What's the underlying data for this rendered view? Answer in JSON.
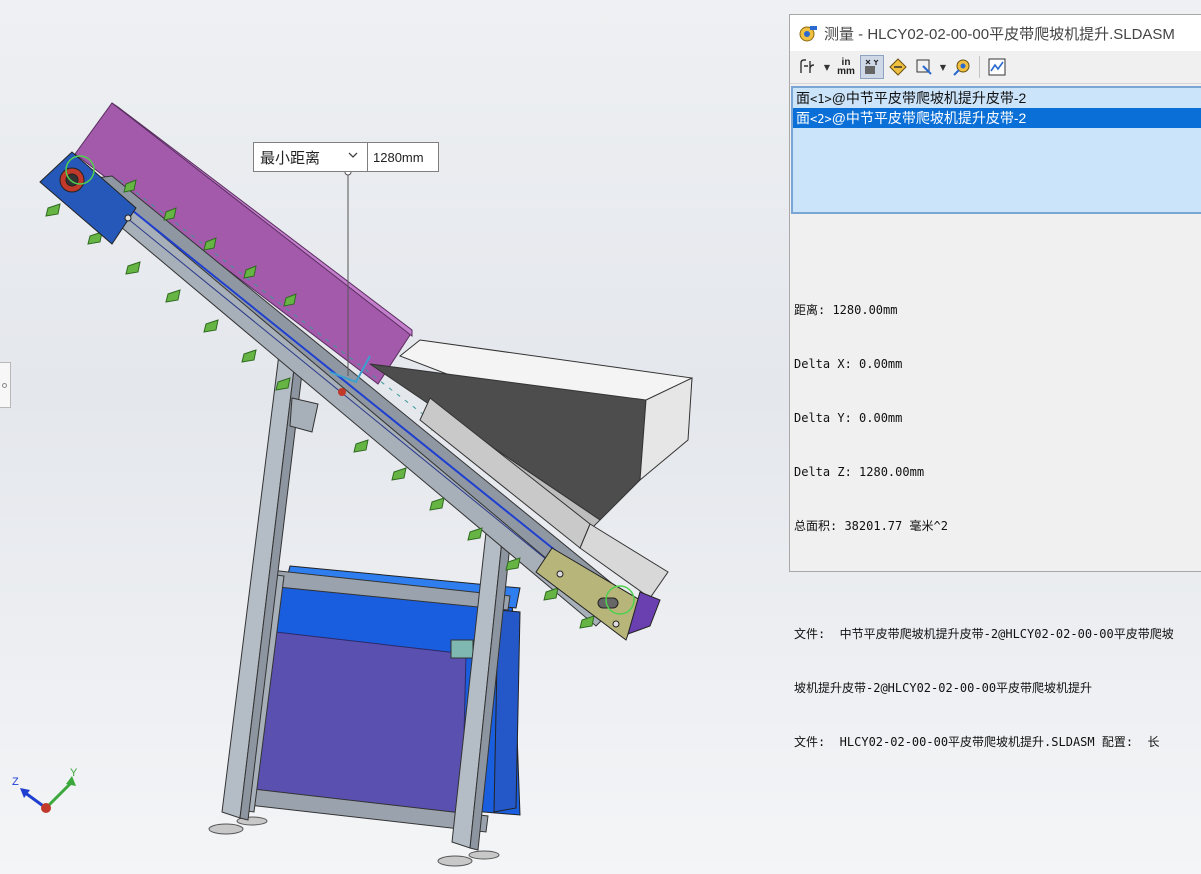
{
  "dimension_callout": {
    "mode_label": "最小距离",
    "value": "1280mm"
  },
  "measure_dialog": {
    "title": "测量 - HLCY02-02-00-00平皮带爬坡机提升.SLDASM",
    "toolbar": {
      "units_label_top": "in",
      "units_label_bottom": "mm"
    },
    "selections": [
      {
        "prefix": "面",
        "tag": "<1>",
        "name": "@中节平皮带爬坡机提升皮带-2"
      },
      {
        "prefix": "面",
        "tag": "<2>",
        "name": "@中节平皮带爬坡机提升皮带-2"
      }
    ],
    "results": {
      "distance": "距离: 1280.00mm",
      "delta_x": "Delta X: 0.00mm",
      "delta_y": "Delta Y: 0.00mm",
      "delta_z": "Delta Z: 1280.00mm",
      "total_area": "总面积: 38201.77 毫米^2",
      "file_line_1": "文件:  中节平皮带爬坡机提升皮带-2@HLCY02-02-00-00平皮带爬坡",
      "file_line_2": "坡机提升皮带-2@HLCY02-02-00-00平皮带爬坡机提升",
      "file_line_3": "文件:  HLCY02-02-00-00平皮带爬坡机提升.SLDASM 配置:  长"
    }
  },
  "triad": {
    "z_label": "Z",
    "y_label": "Y"
  },
  "colors": {
    "belt_purple": "#a35aab",
    "frame_blue": "#2b5fd9",
    "plate_tan": "#b7b57a",
    "hopper_dark": "#4d4d4d",
    "cleat_green": "#66b544",
    "selection_blue": "#0a6fd6"
  }
}
